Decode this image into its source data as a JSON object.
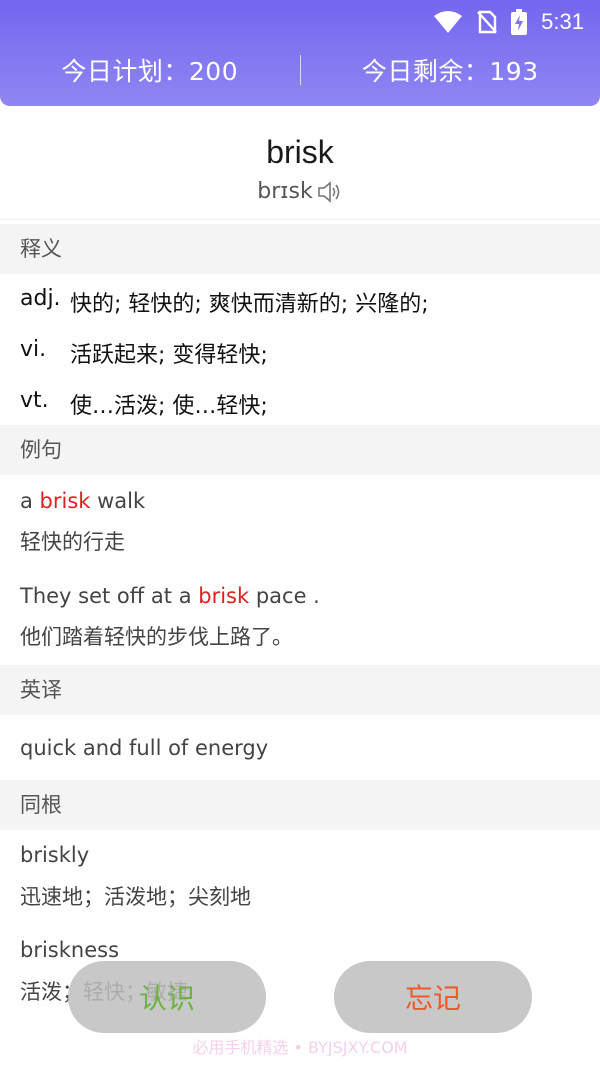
{
  "status_bar": {
    "time": "5:31",
    "icons": [
      "wifi-icon",
      "no-sim-icon",
      "battery-charging-icon"
    ]
  },
  "plan": {
    "today_plan": "今日计划：200",
    "today_remaining": "今日剩余：193"
  },
  "word": {
    "text": "brisk",
    "phonetic": "brɪsk",
    "audio_icon": "speaker-icon"
  },
  "definitions": {
    "title": "释义",
    "items": [
      {
        "pos": "adj.",
        "text": "快的; 轻快的; 爽快而清新的; 兴隆的;"
      },
      {
        "pos": "vi.",
        "text": "活跃起来; 变得轻快;"
      },
      {
        "pos": "vt.",
        "text": "使…活泼; 使…轻快;"
      }
    ]
  },
  "examples": {
    "title": "例句",
    "items": [
      {
        "before": "a ",
        "highlight": "brisk",
        "after": " walk",
        "cn": "轻快的行走"
      },
      {
        "before": "They set off at a ",
        "highlight": "brisk",
        "after": " pace .",
        "cn": "他们踏着轻快的步伐上路了。"
      }
    ]
  },
  "english": {
    "title": "英译",
    "text": "quick and full of energy"
  },
  "cognates": {
    "title": "同根",
    "items": [
      {
        "word": "briskly",
        "cn": "迅速地；活泼地；尖刻地"
      },
      {
        "word": "briskness",
        "cn": "活泼；轻快；敏捷"
      }
    ]
  },
  "buttons": {
    "know": "认识",
    "forget": "忘记"
  },
  "watermark": "必用手机精选 • BYJSJXY.COM",
  "colors": {
    "header": "#7466ee",
    "highlight": "#dd2222",
    "know": "#6db33f",
    "forget": "#ee5a2a"
  }
}
